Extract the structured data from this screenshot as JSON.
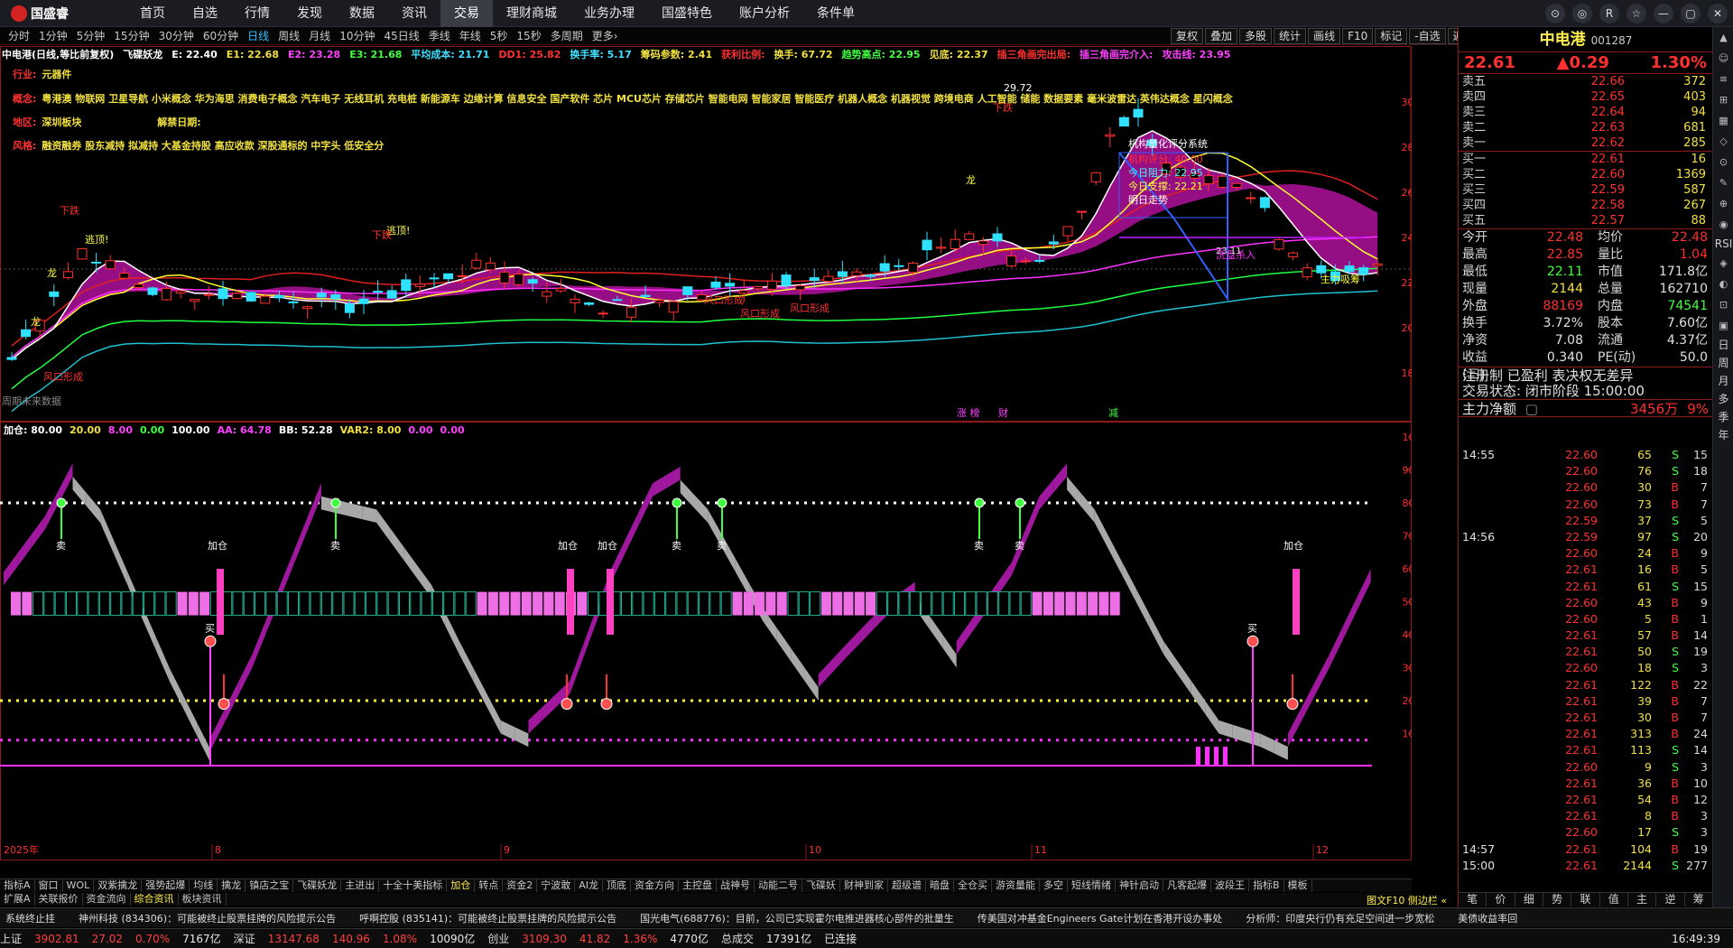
{
  "app": {
    "logo_text": "国盛睿"
  },
  "mainmenu": [
    "首页",
    "自选",
    "行情",
    "发现",
    "数据",
    "资讯",
    "交易",
    "理财商城",
    "业务办理",
    "国盛特色",
    "账户分析",
    "条件单"
  ],
  "wintools": [
    "⊙",
    "◎",
    "R",
    "☆",
    "—",
    "▢",
    "✕"
  ],
  "periods": [
    "分时",
    "1分钟",
    "5分钟",
    "15分钟",
    "30分钟",
    "60分钟",
    "日线",
    "周线",
    "月线",
    "10分钟",
    "45日线",
    "季线",
    "年线",
    "5秒",
    "15秒",
    "多周期",
    "更多›"
  ],
  "active_period": "日线",
  "righttools": [
    "复权",
    "叠加",
    "多股",
    "统计",
    "画线",
    "F10",
    "标记",
    "-自选",
    "返回"
  ],
  "infoline": [
    {
      "text": "中电港(日线,等比前复权)",
      "cls": "info-wht"
    },
    {
      "text": "飞碟妖龙",
      "cls": "info-wht"
    },
    {
      "text": "E: 22.40",
      "cls": "info-wht"
    },
    {
      "text": "E1: 22.68",
      "cls": "info-yel"
    },
    {
      "text": "E2: 23.28",
      "cls": "info-mag"
    },
    {
      "text": "E3: 21.68",
      "cls": "info-grn"
    },
    {
      "text": "平均成本: 21.71",
      "cls": "info-cyn"
    },
    {
      "text": "DD1: 25.82",
      "cls": "info-red"
    },
    {
      "text": "换手率: 5.17",
      "cls": "info-cyn"
    },
    {
      "text": "筹码参数: 2.41",
      "cls": "info-yel"
    },
    {
      "text": "获利比例:",
      "cls": "info-red"
    },
    {
      "text": "换手: 67.72",
      "cls": "info-yel"
    },
    {
      "text": "趋势高点: 22.95",
      "cls": "info-grn"
    },
    {
      "text": "见底: 22.37",
      "cls": "info-yel"
    },
    {
      "text": "插三角画完出局:",
      "cls": "info-red"
    },
    {
      "text": "插三角画完介入:",
      "cls": "info-mag"
    },
    {
      "text": "攻击线: 23.95",
      "cls": "info-mag"
    }
  ],
  "stockinfo": {
    "industry_label": "行业:",
    "industry": "元器件",
    "concept_label": "概念:",
    "concept": "粤港澳 物联网 卫星导航 小米概念 华为海思 消费电子概念 汽车电子 无线耳机 充电桩 新能源车 边缘计算 信息安全 国产软件 芯片 MCU芯片 存储芯片 智能电网 智能家居 智能医疗 机器人概念 机器视觉 跨境电商 人工智能 储能 数据要素 毫米波雷达 英伟达概念 星闪概念",
    "region_label": "地区:",
    "region": "深圳板块",
    "unlock_label": "解禁日期:",
    "style_label": "风格:",
    "style": "融资融券 股东减持 拟减持 大基金持股 高应收款 深股通标的 中字头 低安全分"
  },
  "price_axis": [
    "30.00",
    "28.00",
    "26.00",
    "24.00",
    "22.00",
    "20.00",
    "18.00"
  ],
  "ind_axis": [
    "100.0",
    "90.00",
    "80.00",
    "70.00",
    "60.00",
    "50.00",
    "40.00",
    "30.00",
    "20.00",
    "10.00"
  ],
  "main_annotations": {
    "top_price": "29.72",
    "quant_title": "机构量化评分系统",
    "quant_score": "机构评分: 40.00",
    "quant_res": "今日阻力: 22.95",
    "quant_sup": "今日支撑: 22.21",
    "quant_last": "明日走势",
    "sell_line": "洗盘杀入",
    "hold": "主力吸筹",
    "future": "周期未来数据",
    "level": "23.11",
    "wind": "风口形成",
    "escape": "逃顶!",
    "dragon": "龙",
    "topsell": "卞头",
    "down": "下跌"
  },
  "event_marks": [
    "涨 榜",
    "财",
    "减"
  ],
  "indline": [
    {
      "text": "加仓: 80.00",
      "cls": "info-wht"
    },
    {
      "text": "20.00",
      "cls": "info-yel"
    },
    {
      "text": "8.00",
      "cls": "info-mag"
    },
    {
      "text": "0.00",
      "cls": "info-grn"
    },
    {
      "text": "100.00",
      "cls": "info-wht"
    },
    {
      "text": "AA: 64.78",
      "cls": "info-mag"
    },
    {
      "text": "BB: 52.28",
      "cls": "info-wht"
    },
    {
      "text": "VAR2: 8.00",
      "cls": "info-yel"
    },
    {
      "text": "0.00",
      "cls": "info-mag"
    },
    {
      "text": "0.00",
      "cls": "info-mag"
    }
  ],
  "ind_labels": {
    "buy": "买",
    "sell": "卖",
    "add": "加仓"
  },
  "date_axis": {
    "year": "2025年",
    "months": [
      "8",
      "9",
      "10",
      "11",
      "12"
    ],
    "period": "日线"
  },
  "tabs1": [
    "指标A",
    "窗口",
    "WOL",
    "双紫擒龙",
    "强势起爆",
    "均线",
    "擒龙",
    "镇店之宝",
    "飞碟妖龙",
    "主进出",
    "十全十美指标",
    "加仓",
    "转点",
    "资金2",
    "宁波敢",
    "AI龙",
    "顶底",
    "资金方向",
    "主控盘",
    "战神号",
    "动能二号",
    "飞碟妖",
    "财神到家",
    "超级谱",
    "暗盘",
    "全仓买",
    "游资量能",
    "多空",
    "短线情绪",
    "神针启动",
    "凡客起爆",
    "波段王",
    "指标B",
    "模板"
  ],
  "tabs1_active": "加仓",
  "tabs2": [
    "扩展A",
    "关联报价",
    "资金流向",
    "综合资讯",
    "板块资讯"
  ],
  "tabs2_active": "综合资讯",
  "tabs2_right": "图文F10 侧边栏 «",
  "news": [
    "系统终止挂",
    "神州科技 (834306)：可能被终止股票挂牌的风险提示公告",
    "呼啊控股 (835141)：可能被终止股票挂牌的风险提示公告",
    "国光电气(688776)：目前，公司已实现霍尔电推进器核心部件的批量生",
    "传美国对冲基金Engineers Gate计划在香港开设办事处",
    "分析师：印度央行仍有充足空间进一步宽松",
    "美债收益率回"
  ],
  "status": [
    {
      "name": "上证",
      "v": "3902.81",
      "c": "27.02",
      "p": "0.70%",
      "amt": "7167亿"
    },
    {
      "name": "深证",
      "v": "13147.68",
      "c": "140.96",
      "p": "1.08%",
      "amt": "10090亿"
    },
    {
      "name": "创业",
      "v": "3109.30",
      "c": "41.82",
      "p": "1.36%",
      "amt": "4770亿"
    }
  ],
  "status_total_label": "总成交",
  "status_total": "17391亿",
  "status_conn": "已连接",
  "status_time": "16:49:39",
  "quote": {
    "name": "中电港",
    "code": "001287",
    "price": "22.61",
    "change": "▲0.29",
    "pct": "1.30%",
    "asks": [
      {
        "lbl": "卖五",
        "px": "22.66",
        "vol": "372"
      },
      {
        "lbl": "卖四",
        "px": "22.65",
        "vol": "403"
      },
      {
        "lbl": "卖三",
        "px": "22.64",
        "vol": "94"
      },
      {
        "lbl": "卖二",
        "px": "22.63",
        "vol": "681"
      },
      {
        "lbl": "卖一",
        "px": "22.62",
        "vol": "285"
      }
    ],
    "bids": [
      {
        "lbl": "买一",
        "px": "22.61",
        "vol": "16"
      },
      {
        "lbl": "买二",
        "px": "22.60",
        "vol": "1369"
      },
      {
        "lbl": "买三",
        "px": "22.59",
        "vol": "587"
      },
      {
        "lbl": "买四",
        "px": "22.58",
        "vol": "267"
      },
      {
        "lbl": "买五",
        "px": "22.57",
        "vol": "88"
      }
    ],
    "stats": [
      {
        "k": "今开",
        "v": "22.48",
        "vc": "c-red",
        "k2": "均价",
        "v2": "22.48",
        "v2c": "c-red"
      },
      {
        "k": "最高",
        "v": "22.85",
        "vc": "c-red",
        "k2": "量比",
        "v2": "1.04",
        "v2c": "c-red"
      },
      {
        "k": "最低",
        "v": "22.11",
        "vc": "c-grn",
        "k2": "市值",
        "v2": "171.8亿",
        "v2c": "c-wht"
      },
      {
        "k": "现量",
        "v": "2144",
        "vc": "c-yel",
        "k2": "总量",
        "v2": "162710",
        "v2c": "c-wht"
      },
      {
        "k": "外盘",
        "v": "88169",
        "vc": "c-red",
        "k2": "内盘",
        "v2": "74541",
        "v2c": "c-grn"
      },
      {
        "k": "换手",
        "v": "3.72%",
        "vc": "c-wht",
        "k2": "股本",
        "v2": "7.60亿",
        "v2c": "c-wht"
      },
      {
        "k": "净资",
        "v": "7.08",
        "vc": "c-wht",
        "k2": "流通",
        "v2": "4.37亿",
        "v2c": "c-wht"
      },
      {
        "k": "收益(三)",
        "v": "0.340",
        "vc": "c-wht",
        "k2": "PE(动)",
        "v2": "50.0",
        "v2c": "c-wht"
      }
    ],
    "line1": "注册制 已盈利 表决权无差异",
    "line2": "交易状态: 闭市阶段 15:00:00",
    "flow_label": "主力净额",
    "flow_value": "3456万",
    "flow_pct": "9%",
    "ticks": [
      {
        "t": "14:55",
        "p": "22.60",
        "v": "65",
        "d": "S",
        "n": "15"
      },
      {
        "t": "",
        "p": "22.60",
        "v": "76",
        "d": "S",
        "n": "18"
      },
      {
        "t": "",
        "p": "22.60",
        "v": "30",
        "d": "B",
        "n": "7"
      },
      {
        "t": "",
        "p": "22.60",
        "v": "73",
        "d": "B",
        "n": "7"
      },
      {
        "t": "",
        "p": "22.59",
        "v": "37",
        "d": "S",
        "n": "5"
      },
      {
        "t": "14:56",
        "p": "22.59",
        "v": "97",
        "d": "S",
        "n": "20"
      },
      {
        "t": "",
        "p": "22.60",
        "v": "24",
        "d": "B",
        "n": "9"
      },
      {
        "t": "",
        "p": "22.61",
        "v": "16",
        "d": "B",
        "n": "5"
      },
      {
        "t": "",
        "p": "22.61",
        "v": "61",
        "d": "S",
        "n": "15"
      },
      {
        "t": "",
        "p": "22.60",
        "v": "43",
        "d": "B",
        "n": "9"
      },
      {
        "t": "",
        "p": "22.60",
        "v": "5",
        "d": "B",
        "n": "1"
      },
      {
        "t": "",
        "p": "22.61",
        "v": "57",
        "d": "B",
        "n": "14"
      },
      {
        "t": "",
        "p": "22.61",
        "v": "50",
        "d": "S",
        "n": "19"
      },
      {
        "t": "",
        "p": "22.60",
        "v": "18",
        "d": "S",
        "n": "3"
      },
      {
        "t": "",
        "p": "22.61",
        "v": "122",
        "d": "B",
        "n": "22"
      },
      {
        "t": "",
        "p": "22.61",
        "v": "39",
        "d": "B",
        "n": "7"
      },
      {
        "t": "",
        "p": "22.61",
        "v": "30",
        "d": "B",
        "n": "7"
      },
      {
        "t": "",
        "p": "22.61",
        "v": "313",
        "d": "B",
        "n": "24"
      },
      {
        "t": "",
        "p": "22.61",
        "v": "113",
        "d": "S",
        "n": "14"
      },
      {
        "t": "",
        "p": "22.60",
        "v": "9",
        "d": "S",
        "n": "3"
      },
      {
        "t": "",
        "p": "22.61",
        "v": "36",
        "d": "B",
        "n": "10"
      },
      {
        "t": "",
        "p": "22.61",
        "v": "54",
        "d": "B",
        "n": "12"
      },
      {
        "t": "",
        "p": "22.61",
        "v": "8",
        "d": "B",
        "n": "3"
      },
      {
        "t": "",
        "p": "22.60",
        "v": "17",
        "d": "S",
        "n": "3"
      },
      {
        "t": "14:57",
        "p": "22.61",
        "v": "104",
        "d": "B",
        "n": "19"
      },
      {
        "t": "15:00",
        "p": "22.61",
        "v": "2144",
        "d": "S",
        "n": "277"
      }
    ],
    "bottom_tabs": [
      "笔",
      "价",
      "细",
      "势",
      "联",
      "值",
      "主",
      "逆",
      "筹"
    ]
  },
  "sidebar": [
    "▲",
    "☺",
    "≡",
    "⊞",
    "▦",
    "◇",
    "⊙",
    "✎",
    "⊕",
    "◉",
    "RSI",
    "◈",
    "◐",
    "⊡",
    "▣",
    "日",
    "周",
    "月",
    "多",
    "季",
    "年"
  ],
  "colors": {
    "up": "#ff3030",
    "down": "#40ff40",
    "frame": "#8b1a1a",
    "accent": "#ffef50"
  }
}
